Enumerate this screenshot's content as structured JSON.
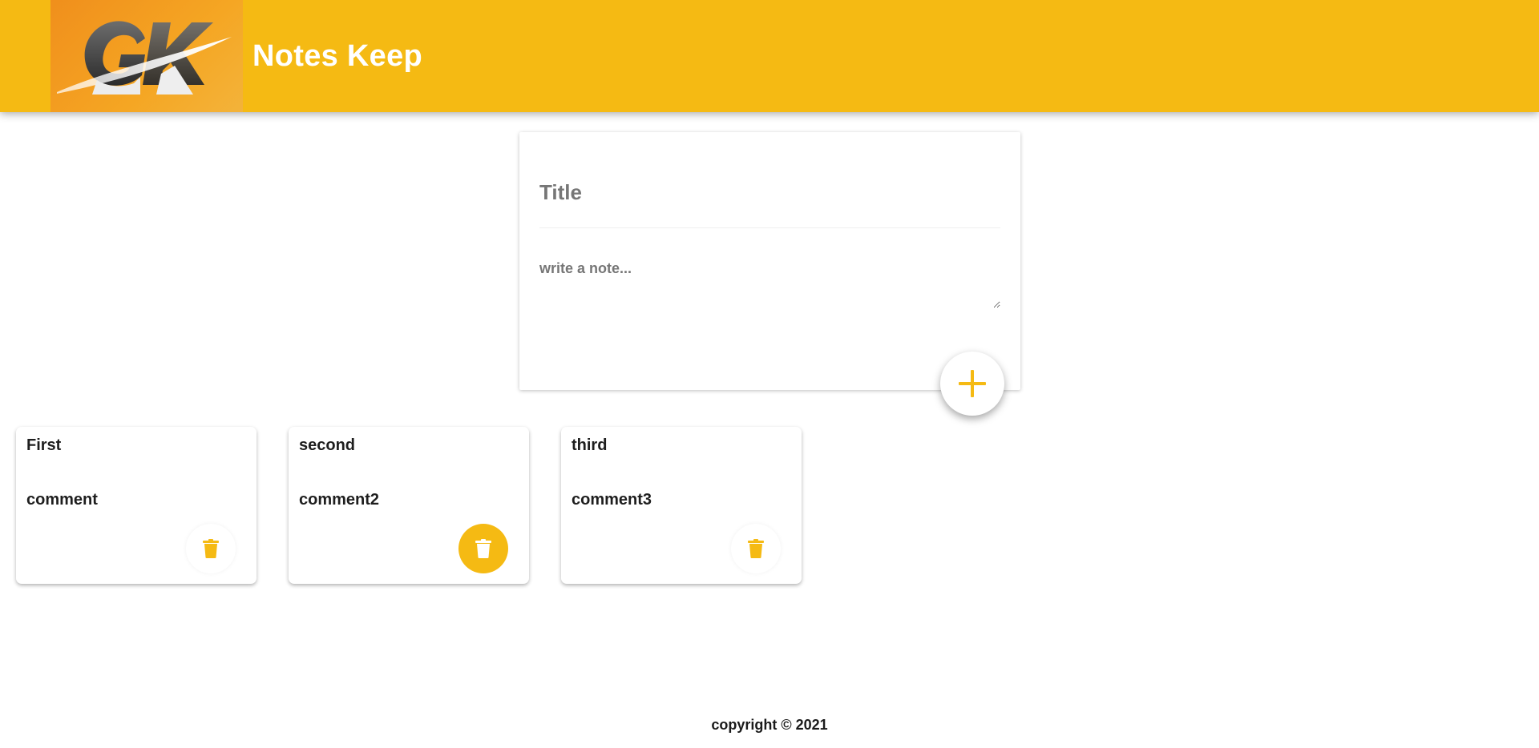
{
  "header": {
    "logo_text": "GK",
    "title": "Notes Keep"
  },
  "create_form": {
    "title_placeholder": "Title",
    "content_placeholder": "write a note...",
    "add_icon": "plus-icon"
  },
  "notes": [
    {
      "title": "First",
      "content": "comment",
      "delete_icon": "trash-icon"
    },
    {
      "title": "second",
      "content": "comment2",
      "delete_icon": "trash-icon"
    },
    {
      "title": "third",
      "content": "comment3",
      "delete_icon": "trash-icon"
    }
  ],
  "footer": {
    "copyright": "copyright © 2021"
  },
  "colors": {
    "accent": "#f5ba13",
    "text": "#1e1e1e",
    "placeholder": "#767676"
  }
}
